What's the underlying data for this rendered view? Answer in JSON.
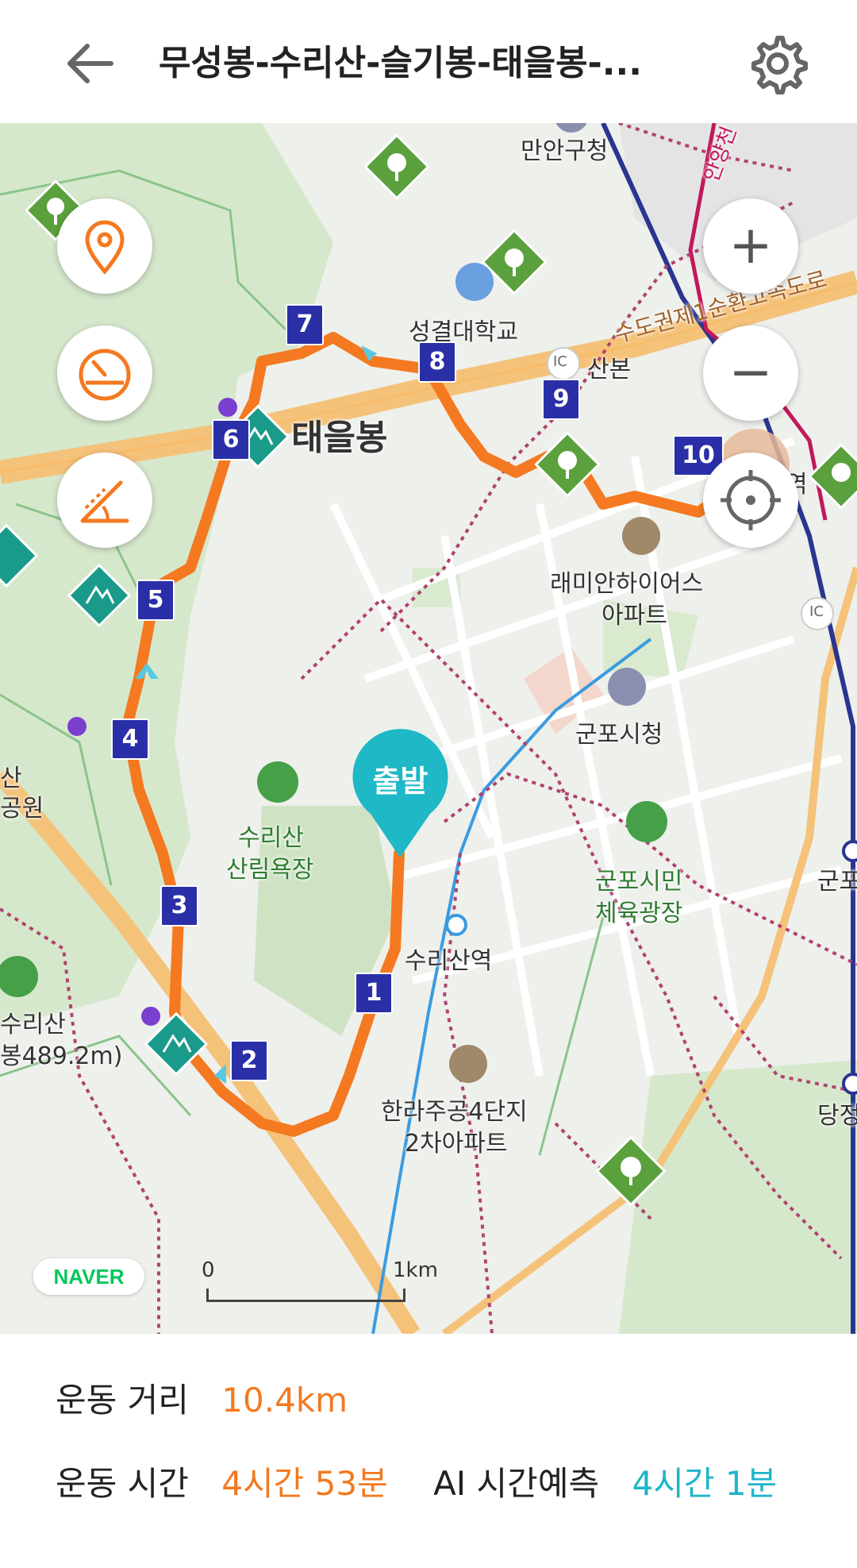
{
  "header": {
    "title": "무성봉-수리산-슬기봉-태을봉-...",
    "back_icon": "back-arrow-icon",
    "settings_icon": "gear-icon"
  },
  "map": {
    "labels": {
      "manan_gu_office": "만안구청",
      "sungkyul_univ": "성결대학교",
      "sanbon": "산본",
      "expressway": "수도권제1순환고속도로",
      "taeulbong": "태을봉",
      "raemian_l1": "래미안하이어스",
      "raemian_l2": "아파트",
      "gunpo_cityhall": "군포시청",
      "surisan_forest_l1": "수리산",
      "surisan_forest_l2": "산림욕장",
      "surisan_station": "수리산역",
      "gunpo_plaza_l1": "군포시민",
      "gunpo_plaza_l2": "체육광장",
      "surisan_peak_l1": "수리산",
      "surisan_peak_l2": "봉489.2m)",
      "hanra_l1": "한라주공4단지",
      "hanra_l2": "2차아파트",
      "park_l1": "산",
      "park_l2": "공원",
      "anyang": "안양천",
      "gunpo_edge": "군포",
      "dangjeong_edge": "당정",
      "ic": "IC",
      "station_edge": "역",
      "start_marker": "출발"
    },
    "waypoints": [
      "1",
      "2",
      "3",
      "4",
      "5",
      "6",
      "7",
      "8",
      "9",
      "10"
    ],
    "controls": {
      "zoom_in": "+",
      "zoom_out": "−"
    },
    "brand": "NAVER",
    "scale": {
      "start": "0",
      "end": "1km"
    },
    "route_color": "#f47920"
  },
  "stats": {
    "distance_label": "운동 거리",
    "distance_value": "10.4km",
    "time_label": "운동 시간",
    "time_value": "4시간 53분",
    "ai_label": "AI 시간예측",
    "ai_value": "4시간 1분"
  }
}
